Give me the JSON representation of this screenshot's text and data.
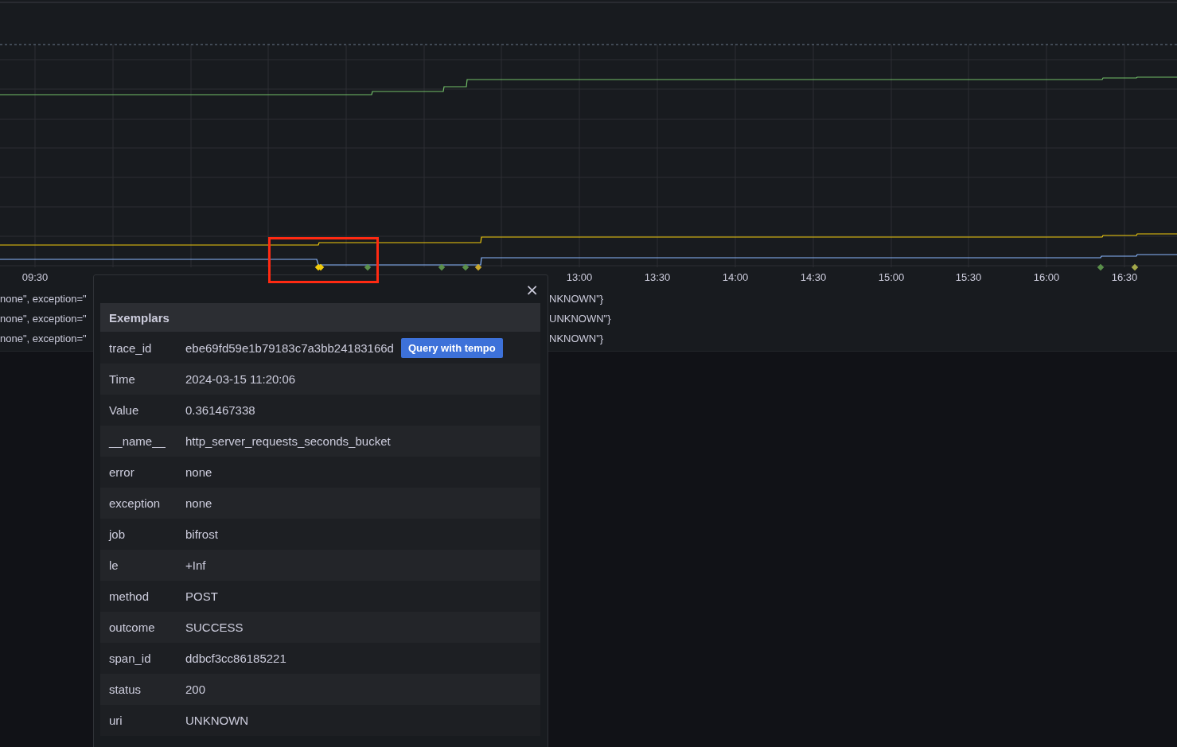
{
  "chart": {
    "x_axis_labels": [
      "09:30",
      "13:00",
      "13:30",
      "14:00",
      "14:30",
      "15:00",
      "15:30",
      "16:00",
      "16:30"
    ]
  },
  "legend": {
    "rows": [
      {
        "left": "none\", exception=\"",
        "right": "NKNOWN\"}"
      },
      {
        "left": "none\", exception=\"",
        "right": "UNKNOWN\"}"
      },
      {
        "left": "none\", exception=\"",
        "right": "NKNOWN\"}"
      }
    ]
  },
  "exemplar_popup": {
    "close": "×",
    "title": "Exemplars",
    "action": "Query with tempo",
    "rows": [
      {
        "label": "trace_id",
        "value": "ebe69fd59e1b79183c7a3bb24183166d",
        "kind": "link"
      },
      {
        "label": "Time",
        "value": "2024-03-15 11:20:06",
        "kind": "plain"
      },
      {
        "label": "Value",
        "value": "0.361467338",
        "kind": "plain"
      },
      {
        "label": "__name__",
        "value": "http_server_requests_seconds_bucket",
        "kind": "plain"
      },
      {
        "label": "error",
        "value": "none",
        "kind": "plain"
      },
      {
        "label": "exception",
        "value": "none",
        "kind": "plain"
      },
      {
        "label": "job",
        "value": "bifrost",
        "kind": "plain"
      },
      {
        "label": "le",
        "value": "+Inf",
        "kind": "plain"
      },
      {
        "label": "method",
        "value": "POST",
        "kind": "plain"
      },
      {
        "label": "outcome",
        "value": "SUCCESS",
        "kind": "plain"
      },
      {
        "label": "span_id",
        "value": "ddbcf3cc86185221",
        "kind": "plain"
      },
      {
        "label": "status",
        "value": "200",
        "kind": "plain"
      },
      {
        "label": "uri",
        "value": "UNKNOWN",
        "kind": "plain"
      }
    ]
  }
}
